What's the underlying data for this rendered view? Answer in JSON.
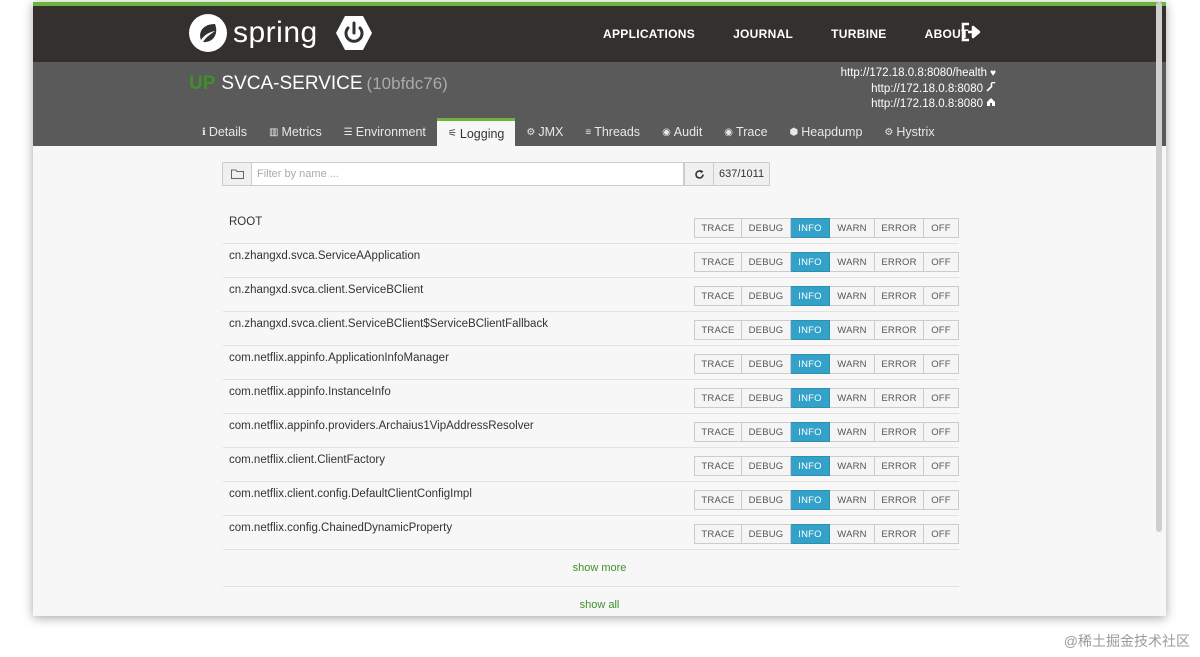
{
  "brand": {
    "name": "spring",
    "color": "#6db33f",
    "logo_icon": "spring-leaf-icon",
    "boot_icon": "power-icon"
  },
  "nav": {
    "items": [
      {
        "label": "APPLICATIONS"
      },
      {
        "label": "JOURNAL"
      },
      {
        "label": "TURBINE"
      },
      {
        "label": "ABOUT"
      }
    ],
    "logout_icon": "sign-out-icon"
  },
  "app": {
    "status": "UP",
    "name": "SVCA-SERVICE",
    "id": "(10bfdc76)",
    "urls": [
      {
        "text": "http://172.18.0.8:8080/health",
        "icon": "heart-icon",
        "glyph": "♥"
      },
      {
        "text": "http://172.18.0.8:8080",
        "icon": "wrench-icon",
        "glyph": "🔧"
      },
      {
        "text": "http://172.18.0.8:8080",
        "icon": "home-icon",
        "glyph": "⌂"
      }
    ]
  },
  "tabs": [
    {
      "label": "Details",
      "icon": "info-icon",
      "glyph": "ℹ"
    },
    {
      "label": "Metrics",
      "icon": "bar-chart-icon",
      "glyph": "▥"
    },
    {
      "label": "Environment",
      "icon": "list-icon",
      "glyph": "☰"
    },
    {
      "label": "Logging",
      "icon": "sliders-icon",
      "glyph": "⚟",
      "active": true
    },
    {
      "label": "JMX",
      "icon": "cogs-icon",
      "glyph": "⚙"
    },
    {
      "label": "Threads",
      "icon": "align-justify-icon",
      "glyph": "≡"
    },
    {
      "label": "Audit",
      "icon": "user-icon",
      "glyph": "◉"
    },
    {
      "label": "Trace",
      "icon": "eye-icon",
      "glyph": "◉"
    },
    {
      "label": "Heapdump",
      "icon": "cubes-icon",
      "glyph": "⬢"
    },
    {
      "label": "Hystrix",
      "icon": "gear-icon",
      "glyph": "⚙"
    }
  ],
  "filter": {
    "placeholder": "Filter by name ...",
    "count": "637/1011",
    "folder_icon": "folder-icon",
    "refresh_icon": "refresh-icon"
  },
  "levels": [
    "TRACE",
    "DEBUG",
    "INFO",
    "WARN",
    "ERROR",
    "OFF"
  ],
  "loggers": [
    {
      "name": "ROOT",
      "level": "INFO"
    },
    {
      "name": "cn.zhangxd.svca.ServiceAApplication",
      "level": "INFO"
    },
    {
      "name": "cn.zhangxd.svca.client.ServiceBClient",
      "level": "INFO"
    },
    {
      "name": "cn.zhangxd.svca.client.ServiceBClient$ServiceBClientFallback",
      "level": "INFO"
    },
    {
      "name": "com.netflix.appinfo.ApplicationInfoManager",
      "level": "INFO"
    },
    {
      "name": "com.netflix.appinfo.InstanceInfo",
      "level": "INFO"
    },
    {
      "name": "com.netflix.appinfo.providers.Archaius1VipAddressResolver",
      "level": "INFO"
    },
    {
      "name": "com.netflix.client.ClientFactory",
      "level": "INFO"
    },
    {
      "name": "com.netflix.client.config.DefaultClientConfigImpl",
      "level": "INFO"
    },
    {
      "name": "com.netflix.config.ChainedDynamicProperty",
      "level": "INFO"
    }
  ],
  "show_more": "show more",
  "show_all": "show all",
  "watermark": "@稀土掘金技术社区"
}
